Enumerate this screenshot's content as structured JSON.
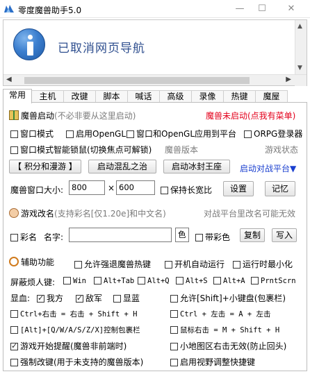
{
  "window": {
    "title": "零度魔兽助手5.0",
    "minimize": "—",
    "maximize": "☐",
    "close": "✕"
  },
  "browser": {
    "nav_text": "已取消网页导航",
    "scroll_left": "◀",
    "scroll_right": "▶",
    "scroll_up": "▲",
    "scroll_down": "▼"
  },
  "tabs": [
    {
      "label": "常用"
    },
    {
      "label": "主机"
    },
    {
      "label": "改键"
    },
    {
      "label": "脚本"
    },
    {
      "label": "喊话"
    },
    {
      "label": "高级"
    },
    {
      "label": "录像"
    },
    {
      "label": "热键"
    },
    {
      "label": "魔屋"
    }
  ],
  "launch": {
    "header": "魔兽启动",
    "header_note": "(不必非要从这里启动)",
    "status": "魔兽未启动(点我有菜单)",
    "cb_window_mode": "窗口模式",
    "cb_opengl": "启用OpenGL",
    "cb_window_opengl_platform": "窗口和OpenGL应用到平台",
    "cb_orpg": "ORPG登录器",
    "cb_smart_lock": "窗口模式智能锁鼠(切换焦点可解锁)",
    "version_label": "魔兽版本",
    "game_state_label": "游戏状态",
    "btn_points": "【 积分和漫游 】",
    "btn_chaos": "启动混乱之治",
    "btn_frozen": "启动冰封王座",
    "battle_platform": "启动对战平台▼",
    "window_size_label": "魔兽窗口大小:",
    "width_value": "800",
    "times": "×",
    "height_value": "600",
    "cb_keep_ratio": "保持长宽比",
    "btn_set": "设置",
    "btn_remember": "记忆"
  },
  "rename": {
    "header": "游戏改名",
    "header_note": "(支持彩名[仅1.20e]和中文名)",
    "platform_note": "对战平台里改名可能无效",
    "cb_color_name": "彩名",
    "name_label": "名字:",
    "name_value": "",
    "color_btn": "色",
    "cb_gradient": "带彩色",
    "btn_copy": "复制",
    "btn_write": "写入"
  },
  "assist": {
    "header": "辅助功能",
    "cb_force_hotkey": "允许强退魔兽热键",
    "cb_autostart": "开机自动运行",
    "cb_minimize": "运行时最小化",
    "block_label": "屏蔽烦人键:",
    "block_keys": [
      {
        "label": "Win",
        "checked": false
      },
      {
        "label": "Alt+Tab",
        "checked": false
      },
      {
        "label": "Alt+Q",
        "checked": false
      },
      {
        "label": "Alt+S",
        "checked": false
      },
      {
        "label": "Alt+A",
        "checked": false
      },
      {
        "label": "PrntScrn",
        "checked": false
      }
    ],
    "hp_label": "显血:",
    "cb_ally": "我方",
    "cb_enemy": "敌军",
    "cb_hp_display": "显蓝",
    "cb_shift_keypad": "允许[Shift]+小键盘(包裹栏)",
    "cb_ctrl_right": "Ctrl+右击 = 右击 + Shift + H",
    "cb_ctrl_left": "Ctrl + 左击 = A + 左击",
    "cb_alt_qwas": "[Alt]+[Q/W/A/S/Z/X]控制包裹栏",
    "cb_mouse_right": "鼠标右击 = M + Shift + H",
    "cb_game_start_alert": "游戏开始提醒(魔兽非前端时)",
    "cb_minimap_right": "小地图区右击无效(防止回头)",
    "cb_force_remap": "强制改键(用于未支持的魔兽版本)",
    "cb_view_hotkey": "启用视野调整快捷键"
  },
  "colors": {
    "accent_red": "#e3001b",
    "accent_blue": "#1a3fcf",
    "nav_text": "#2f4f8f",
    "info_icon": "#3c7fcf"
  }
}
